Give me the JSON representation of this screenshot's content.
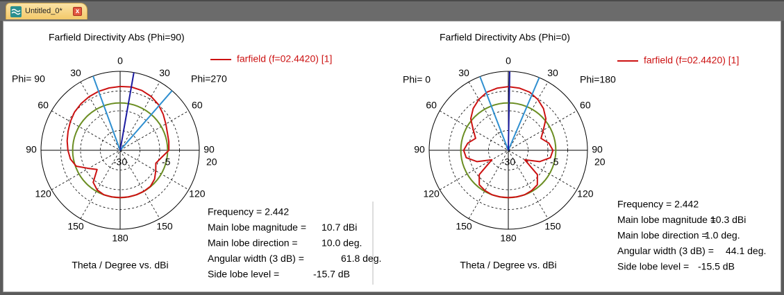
{
  "tab": {
    "title": "Untitled_0*",
    "close_symbol": "x"
  },
  "colors": {
    "pattern": "#cc1111",
    "reference_circle": "#6b8e23",
    "main_lobe": "#1a1aa0",
    "beamwidth": "#2f8fd0",
    "grid": "#000000",
    "text_red": "#cc1111"
  },
  "chart_data": [
    {
      "type": "polar",
      "title": "Farfield Directivity Abs (Phi=90)",
      "legend": "farfield (f=02.4420) [1]",
      "legend_position": "top-right",
      "left_label": "Phi= 90",
      "right_label": "Phi=270",
      "xlabel": "Theta / Degree vs. dBi",
      "angle_ticks_left": [
        "0",
        "30",
        "60",
        "90",
        "120",
        "150",
        "180"
      ],
      "angle_ticks_right": [
        "30",
        "60",
        "90",
        "120",
        "150"
      ],
      "radial_ticks": [
        "-30",
        "-5",
        "20"
      ],
      "radial_range_dBi": [
        -30,
        20
      ],
      "main_lobe_direction_deg": 10.0,
      "beam_edges_deg": [
        -20,
        41
      ],
      "theta_deg": [
        0,
        10,
        20,
        30,
        40,
        50,
        60,
        70,
        80,
        90,
        100,
        110,
        120,
        130,
        140,
        150,
        160,
        170,
        180,
        -170,
        -160,
        -150,
        -140,
        -130,
        -120,
        -110,
        -100,
        -90,
        -80,
        -70,
        -60,
        -50,
        -40,
        -30,
        -20,
        -10
      ],
      "directivity_dBi": [
        10.4,
        10.7,
        10.3,
        9.3,
        7.7,
        5.5,
        3.3,
        1.8,
        1.2,
        0.8,
        -3.5,
        -6.0,
        -4.0,
        -1.6,
        -0.2,
        0.0,
        0.0,
        0.0,
        0.0,
        0.0,
        0.0,
        -1.0,
        -3.5,
        -11.0,
        -7.0,
        -0.5,
        1.9,
        3.0,
        4.0,
        5.0,
        6.3,
        7.6,
        8.5,
        9.2,
        9.7,
        10.1
      ],
      "info": [
        {
          "label": "Frequency = 2.442"
        },
        {
          "label": "Main lobe magnitude =",
          "value": "10.7 dBi"
        },
        {
          "label": "Main lobe direction =",
          "value": "10.0 deg."
        },
        {
          "label": "Angular width (3 dB) =",
          "value": "61.8 deg."
        },
        {
          "label": "Side lobe level =",
          "value": "-15.7 dB"
        }
      ]
    },
    {
      "type": "polar",
      "title": "Farfield Directivity Abs (Phi=0)",
      "legend": "farfield (f=02.4420) [1]",
      "legend_position": "top-right",
      "left_label": "Phi=  0",
      "right_label": "Phi=180",
      "xlabel": "Theta / Degree vs. dBi",
      "angle_ticks_left": [
        "0",
        "30",
        "60",
        "90",
        "120",
        "150",
        "180"
      ],
      "angle_ticks_right": [
        "30",
        "60",
        "90",
        "120",
        "150"
      ],
      "radial_ticks": [
        "-30",
        "-5",
        "20"
      ],
      "radial_range_dBi": [
        -30,
        20
      ],
      "main_lobe_direction_deg": 1.0,
      "beam_edges_deg": [
        -21,
        23
      ],
      "theta_deg": [
        0,
        10,
        20,
        30,
        40,
        50,
        60,
        70,
        80,
        90,
        100,
        110,
        120,
        130,
        140,
        150,
        160,
        170,
        180,
        -170,
        -160,
        -150,
        -140,
        -130,
        -120,
        -110,
        -100,
        -90,
        -80,
        -70,
        -60,
        -50,
        -40,
        -30,
        -20,
        -10
      ],
      "directivity_dBi": [
        10.3,
        10.0,
        9.2,
        7.2,
        4.5,
        1.0,
        -4.5,
        -8.0,
        -4.0,
        -1.8,
        -3.0,
        -9.0,
        -18.0,
        -6.0,
        -1.5,
        -0.5,
        0.0,
        0.0,
        0.0,
        0.0,
        0.0,
        -0.5,
        -1.5,
        -6.0,
        -18.0,
        -9.0,
        -3.0,
        -1.8,
        -4.0,
        -8.0,
        -4.5,
        1.0,
        4.5,
        7.2,
        9.2,
        10.0
      ],
      "info": [
        {
          "label": "Frequency = 2.442"
        },
        {
          "label": "Main lobe magnitude =",
          "value": "10.3 dBi"
        },
        {
          "label": "Main lobe direction =",
          "value": "1.0 deg."
        },
        {
          "label": "Angular width (3 dB) =",
          "value": "44.1 deg."
        },
        {
          "label": "Side lobe level =",
          "value": "-15.5 dB"
        }
      ]
    }
  ]
}
